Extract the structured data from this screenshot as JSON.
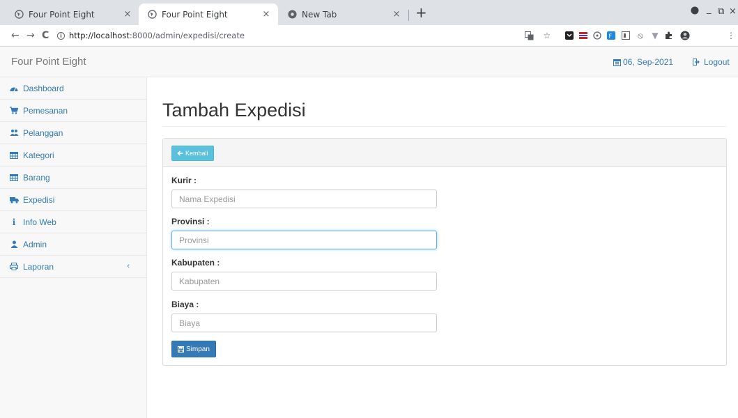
{
  "browser": {
    "tabs": [
      {
        "title": "Four Point Eight",
        "active": false
      },
      {
        "title": "Four Point Eight",
        "active": true
      },
      {
        "title": "New Tab",
        "active": false
      }
    ],
    "tab_close_glyph": "×",
    "new_tab_glyph": "+",
    "url_host": "http://localhost",
    "url_path": ":8000/admin/expedisi/create",
    "nav": {
      "back": "←",
      "forward": "→",
      "reload": "C"
    },
    "window": {
      "minimize": "_",
      "restore": "⧉",
      "close": "×"
    }
  },
  "app": {
    "brand": "Four Point Eight",
    "date": "06, Sep-2021",
    "logout": "Logout"
  },
  "sidebar": {
    "items": [
      {
        "label": "Dashboard",
        "icon": "dashboard-icon"
      },
      {
        "label": "Pemesanan",
        "icon": "cart-icon"
      },
      {
        "label": "Pelanggan",
        "icon": "users-icon"
      },
      {
        "label": "Kategori",
        "icon": "table-icon"
      },
      {
        "label": "Barang",
        "icon": "table-icon"
      },
      {
        "label": "Expedisi",
        "icon": "truck-icon"
      },
      {
        "label": "Info Web",
        "icon": "info-icon"
      },
      {
        "label": "Admin",
        "icon": "user-icon"
      },
      {
        "label": "Laporan",
        "icon": "print-icon",
        "chevron": "‹"
      }
    ]
  },
  "page": {
    "title": "Tambah Expedisi",
    "back_button": "Kembali",
    "save_button": "Simpan",
    "fields": [
      {
        "label": "Kurir :",
        "placeholder": "Nama Expedisi",
        "value": ""
      },
      {
        "label": "Provinsi :",
        "placeholder": "Provinsi",
        "value": ""
      },
      {
        "label": "Kabupaten :",
        "placeholder": "Kabupaten",
        "value": ""
      },
      {
        "label": "Biaya :",
        "placeholder": "Biaya",
        "value": ""
      }
    ]
  },
  "colors": {
    "link": "#337ab7",
    "info_button": "#5bc0de",
    "primary_button": "#337ab7",
    "sidebar_bg": "#f8f8f8"
  }
}
